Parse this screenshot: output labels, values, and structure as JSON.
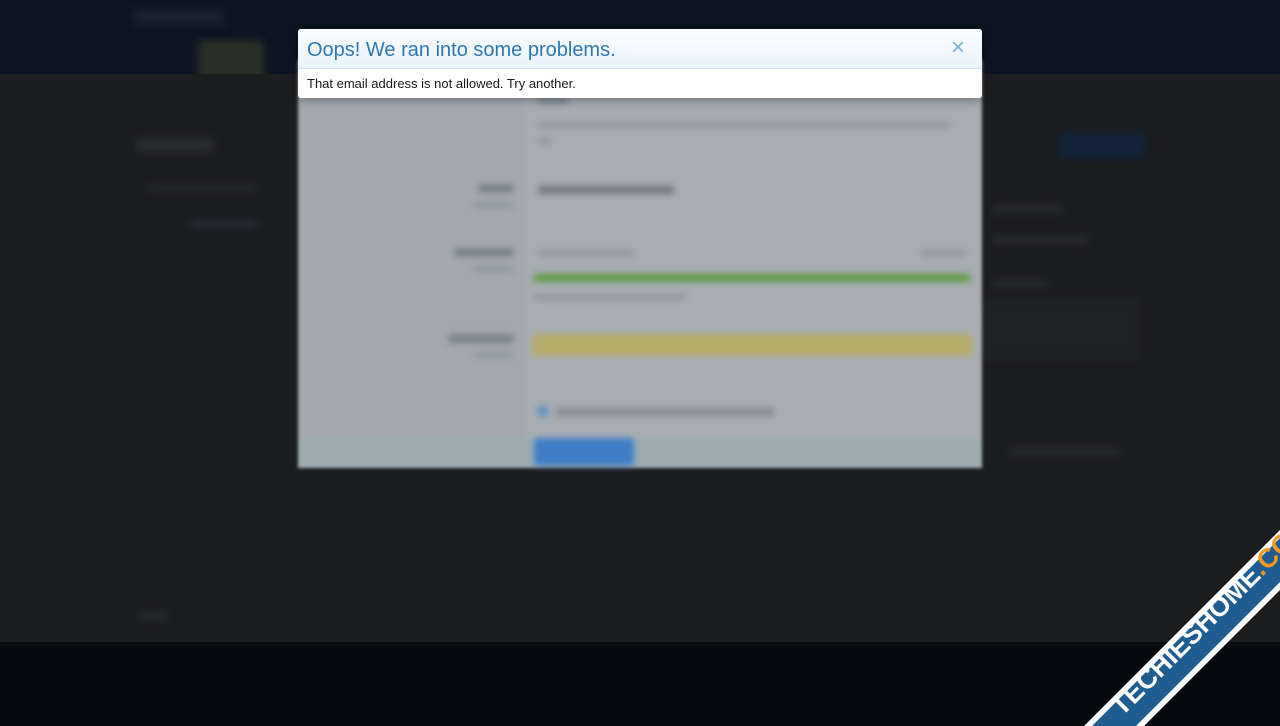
{
  "modal": {
    "title": "Oops! We ran into some problems.",
    "close_symbol": "×",
    "message": "That email address is not allowed. Try another."
  },
  "watermark": {
    "text_part1": "TECHIES",
    "text_part2": "HOME",
    "text_part3": ".COM"
  },
  "colors": {
    "modal_title": "#2d78b4",
    "close_icon": "#7fb0d8",
    "watermark_band": "#1f5c8f",
    "watermark_accent": "#f29a1f"
  }
}
